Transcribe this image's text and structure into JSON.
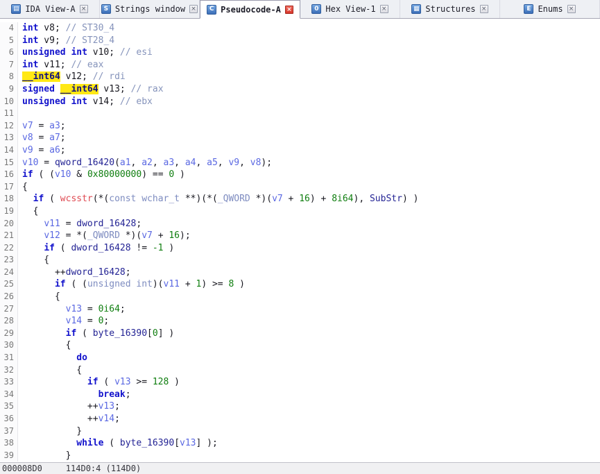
{
  "tabbar": {
    "close_glyph": "×",
    "tabs": [
      {
        "label": "IDA View-A",
        "icon": "ida-view-icon",
        "glyph": "▤",
        "active": false
      },
      {
        "label": "Strings window",
        "icon": "strings-icon",
        "glyph": "S",
        "active": false
      },
      {
        "label": "Pseudocode-A",
        "icon": "pseudocode-icon",
        "glyph": "C",
        "active": true
      },
      {
        "label": "Hex View-1",
        "icon": "hex-view-icon",
        "glyph": "0",
        "active": false
      },
      {
        "label": "Structures",
        "icon": "structures-icon",
        "glyph": "▦",
        "active": false
      },
      {
        "label": "Enums",
        "icon": "enums-icon",
        "glyph": "E",
        "active": false
      }
    ]
  },
  "colors": {
    "highlight_background": "#ffe814",
    "active_close_red": "#d8372b",
    "keyword_blue": "#1212cc",
    "local_var_blue": "#5a68e2",
    "global_navy": "#232394",
    "number_green": "#0e7d0e",
    "comment_gray_blue": "#8593bb",
    "import_red": "#df4a52"
  },
  "code": {
    "lines": [
      {
        "n": 4,
        "s": [
          [
            "k",
            "int"
          ],
          [
            "p",
            " v8; "
          ],
          [
            "c",
            "// ST30_4"
          ]
        ]
      },
      {
        "n": 5,
        "s": [
          [
            "k",
            "int"
          ],
          [
            "p",
            " v9; "
          ],
          [
            "c",
            "// ST28_4"
          ]
        ]
      },
      {
        "n": 6,
        "s": [
          [
            "k",
            "unsigned int"
          ],
          [
            "p",
            " v10; "
          ],
          [
            "c",
            "// esi"
          ]
        ]
      },
      {
        "n": 7,
        "s": [
          [
            "k",
            "int"
          ],
          [
            "p",
            " v11; "
          ],
          [
            "c",
            "// eax"
          ]
        ]
      },
      {
        "n": 8,
        "s": [
          [
            "h",
            "__int64"
          ],
          [
            "p",
            " v12; "
          ],
          [
            "c",
            "// rdi"
          ]
        ]
      },
      {
        "n": 9,
        "s": [
          [
            "k",
            "signed"
          ],
          [
            "p",
            " "
          ],
          [
            "h",
            "__int64"
          ],
          [
            "p",
            " v13; "
          ],
          [
            "c",
            "// rax"
          ]
        ]
      },
      {
        "n": 10,
        "s": [
          [
            "k",
            "unsigned int"
          ],
          [
            "p",
            " v14; "
          ],
          [
            "c",
            "// ebx"
          ]
        ]
      },
      {
        "n": 11,
        "s": []
      },
      {
        "n": 12,
        "s": [
          [
            "v",
            "v7"
          ],
          [
            "p",
            " = "
          ],
          [
            "v",
            "a3"
          ],
          [
            "p",
            ";"
          ]
        ]
      },
      {
        "n": 13,
        "s": [
          [
            "v",
            "v8"
          ],
          [
            "p",
            " = "
          ],
          [
            "v",
            "a7"
          ],
          [
            "p",
            ";"
          ]
        ]
      },
      {
        "n": 14,
        "s": [
          [
            "v",
            "v9"
          ],
          [
            "p",
            " = "
          ],
          [
            "v",
            "a6"
          ],
          [
            "p",
            ";"
          ]
        ]
      },
      {
        "n": 15,
        "s": [
          [
            "v",
            "v10"
          ],
          [
            "p",
            " = "
          ],
          [
            "g",
            "qword_16420"
          ],
          [
            "p",
            "("
          ],
          [
            "v",
            "a1"
          ],
          [
            "p",
            ", "
          ],
          [
            "v",
            "a2"
          ],
          [
            "p",
            ", "
          ],
          [
            "v",
            "a3"
          ],
          [
            "p",
            ", "
          ],
          [
            "v",
            "a4"
          ],
          [
            "p",
            ", "
          ],
          [
            "v",
            "a5"
          ],
          [
            "p",
            ", "
          ],
          [
            "v",
            "v9"
          ],
          [
            "p",
            ", "
          ],
          [
            "v",
            "v8"
          ],
          [
            "p",
            ");"
          ]
        ]
      },
      {
        "n": 16,
        "s": [
          [
            "k",
            "if"
          ],
          [
            "p",
            " ( ("
          ],
          [
            "v",
            "v10"
          ],
          [
            "p",
            " & "
          ],
          [
            "n",
            "0x80000000"
          ],
          [
            "p",
            ") == "
          ],
          [
            "n",
            "0"
          ],
          [
            "p",
            " )"
          ]
        ]
      },
      {
        "n": 17,
        "s": [
          [
            "p",
            "{"
          ]
        ]
      },
      {
        "n": 18,
        "s": [
          [
            "p",
            "  "
          ],
          [
            "k",
            "if"
          ],
          [
            "p",
            " ( "
          ],
          [
            "f",
            "wcsstr"
          ],
          [
            "p",
            "(*("
          ],
          [
            "t",
            "const wchar_t"
          ],
          [
            "p",
            " **)(*("
          ],
          [
            "t",
            "_QWORD"
          ],
          [
            "p",
            " *)("
          ],
          [
            "v",
            "v7"
          ],
          [
            "p",
            " + "
          ],
          [
            "n",
            "16"
          ],
          [
            "p",
            ") + "
          ],
          [
            "n",
            "8i64"
          ],
          [
            "p",
            "), "
          ],
          [
            "g",
            "SubStr"
          ],
          [
            "p",
            ") )"
          ]
        ]
      },
      {
        "n": 19,
        "s": [
          [
            "p",
            "  {"
          ]
        ]
      },
      {
        "n": 20,
        "s": [
          [
            "p",
            "    "
          ],
          [
            "v",
            "v11"
          ],
          [
            "p",
            " = "
          ],
          [
            "g",
            "dword_16428"
          ],
          [
            "p",
            ";"
          ]
        ]
      },
      {
        "n": 21,
        "s": [
          [
            "p",
            "    "
          ],
          [
            "v",
            "v12"
          ],
          [
            "p",
            " = *("
          ],
          [
            "t",
            "_QWORD"
          ],
          [
            "p",
            " *)("
          ],
          [
            "v",
            "v7"
          ],
          [
            "p",
            " + "
          ],
          [
            "n",
            "16"
          ],
          [
            "p",
            ");"
          ]
        ]
      },
      {
        "n": 22,
        "s": [
          [
            "p",
            "    "
          ],
          [
            "k",
            "if"
          ],
          [
            "p",
            " ( "
          ],
          [
            "g",
            "dword_16428"
          ],
          [
            "p",
            " != "
          ],
          [
            "n",
            "-1"
          ],
          [
            "p",
            " )"
          ]
        ]
      },
      {
        "n": 23,
        "s": [
          [
            "p",
            "    {"
          ]
        ]
      },
      {
        "n": 24,
        "s": [
          [
            "p",
            "      ++"
          ],
          [
            "g",
            "dword_16428"
          ],
          [
            "p",
            ";"
          ]
        ]
      },
      {
        "n": 25,
        "s": [
          [
            "p",
            "      "
          ],
          [
            "k",
            "if"
          ],
          [
            "p",
            " ( ("
          ],
          [
            "t",
            "unsigned int"
          ],
          [
            "p",
            ")("
          ],
          [
            "v",
            "v11"
          ],
          [
            "p",
            " + "
          ],
          [
            "n",
            "1"
          ],
          [
            "p",
            ") >= "
          ],
          [
            "n",
            "8"
          ],
          [
            "p",
            " )"
          ]
        ]
      },
      {
        "n": 26,
        "s": [
          [
            "p",
            "      {"
          ]
        ]
      },
      {
        "n": 27,
        "s": [
          [
            "p",
            "        "
          ],
          [
            "v",
            "v13"
          ],
          [
            "p",
            " = "
          ],
          [
            "n",
            "0i64"
          ],
          [
            "p",
            ";"
          ]
        ]
      },
      {
        "n": 28,
        "s": [
          [
            "p",
            "        "
          ],
          [
            "v",
            "v14"
          ],
          [
            "p",
            " = "
          ],
          [
            "n",
            "0"
          ],
          [
            "p",
            ";"
          ]
        ]
      },
      {
        "n": 29,
        "s": [
          [
            "p",
            "        "
          ],
          [
            "k",
            "if"
          ],
          [
            "p",
            " ( "
          ],
          [
            "g",
            "byte_16390"
          ],
          [
            "p",
            "["
          ],
          [
            "n",
            "0"
          ],
          [
            "p",
            "] )"
          ]
        ]
      },
      {
        "n": 30,
        "s": [
          [
            "p",
            "        {"
          ]
        ]
      },
      {
        "n": 31,
        "s": [
          [
            "p",
            "          "
          ],
          [
            "k",
            "do"
          ]
        ]
      },
      {
        "n": 32,
        "s": [
          [
            "p",
            "          {"
          ]
        ]
      },
      {
        "n": 33,
        "s": [
          [
            "p",
            "            "
          ],
          [
            "k",
            "if"
          ],
          [
            "p",
            " ( "
          ],
          [
            "v",
            "v13"
          ],
          [
            "p",
            " >= "
          ],
          [
            "n",
            "128"
          ],
          [
            "p",
            " )"
          ]
        ]
      },
      {
        "n": 34,
        "s": [
          [
            "p",
            "              "
          ],
          [
            "k",
            "break"
          ],
          [
            "p",
            ";"
          ]
        ]
      },
      {
        "n": 35,
        "s": [
          [
            "p",
            "            ++"
          ],
          [
            "v",
            "v13"
          ],
          [
            "p",
            ";"
          ]
        ]
      },
      {
        "n": 36,
        "s": [
          [
            "p",
            "            ++"
          ],
          [
            "v",
            "v14"
          ],
          [
            "p",
            ";"
          ]
        ]
      },
      {
        "n": 37,
        "s": [
          [
            "p",
            "          }"
          ]
        ]
      },
      {
        "n": 38,
        "s": [
          [
            "p",
            "          "
          ],
          [
            "k",
            "while"
          ],
          [
            "p",
            " ( "
          ],
          [
            "g",
            "byte_16390"
          ],
          [
            "p",
            "["
          ],
          [
            "v",
            "v13"
          ],
          [
            "p",
            "] );"
          ]
        ]
      },
      {
        "n": 39,
        "s": [
          [
            "p",
            "        }"
          ]
        ]
      }
    ]
  },
  "status": {
    "address": "000008D0",
    "position": "114D0:4 (114D0)"
  }
}
